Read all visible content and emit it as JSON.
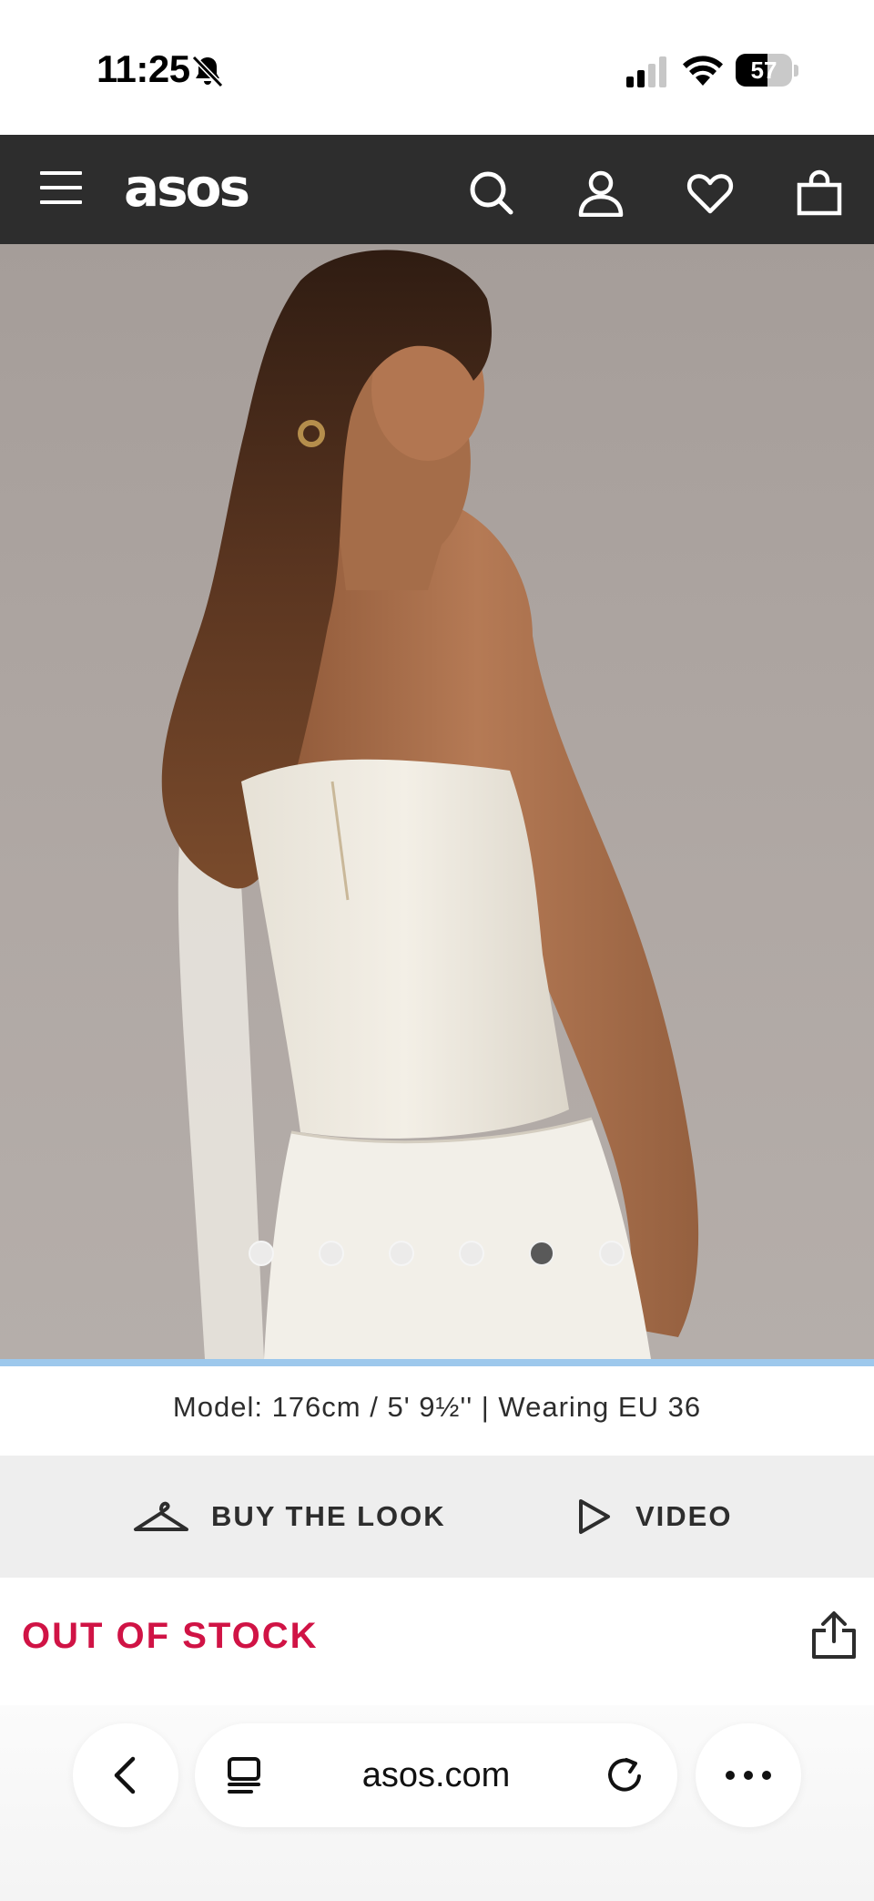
{
  "status_bar": {
    "time": "11:25",
    "battery_level": "57",
    "battery_fraction": 0.57,
    "icons": [
      "bell-slash-icon",
      "cellular-signal-icon",
      "wifi-icon",
      "battery-icon"
    ]
  },
  "header": {
    "logo": "asos",
    "icons": [
      "menu-icon",
      "search-icon",
      "account-icon",
      "heart-icon",
      "bag-icon"
    ],
    "background": "#2d2d2d"
  },
  "gallery": {
    "image_alt": "Model wearing a white strapless peplum top with a chiffon drape, photographed from behind",
    "slides_total": 6,
    "active_index": 4
  },
  "model_info": "Model: 176cm / 5' 9½'' | Wearing EU 36",
  "actions": {
    "buy_the_look": "BUY THE LOOK",
    "video": "VIDEO"
  },
  "product": {
    "stock_status": "OUT OF STOCK",
    "stock_color": "#d01345"
  },
  "browser": {
    "url": "asos.com",
    "icons": [
      "back-icon",
      "tabs-icon",
      "reload-icon",
      "more-icon"
    ]
  }
}
